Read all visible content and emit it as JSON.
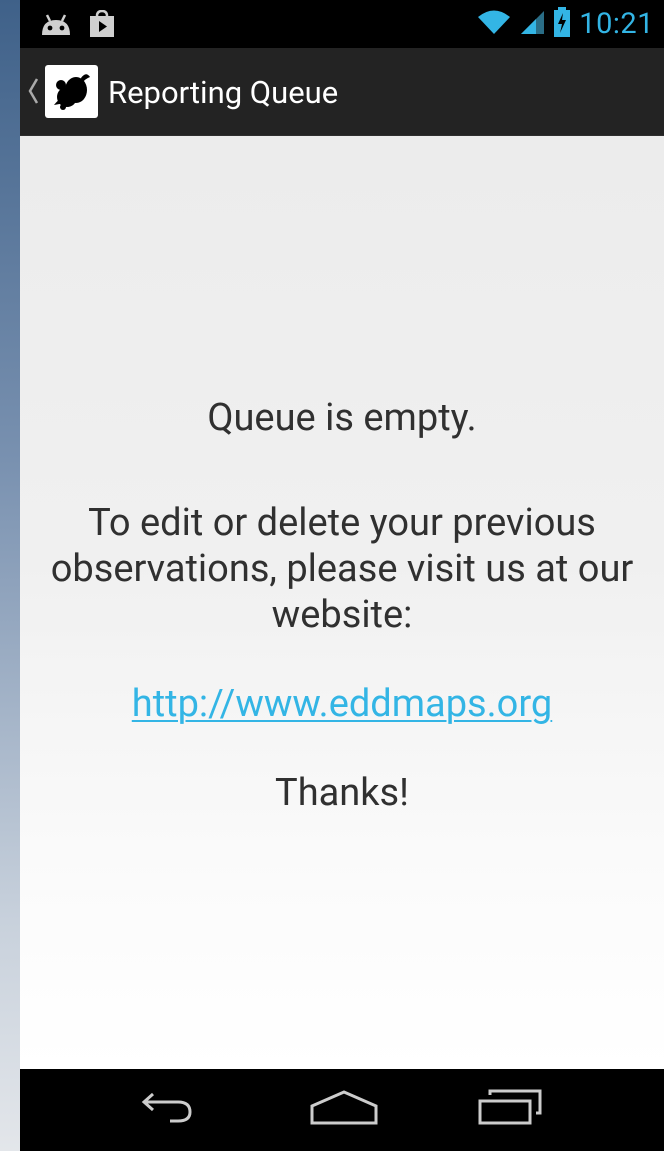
{
  "status_bar": {
    "time": "10:21",
    "left_icons": [
      "android-notification-icon",
      "play-store-icon"
    ],
    "right_icons": [
      "wifi-icon",
      "signal-icon",
      "battery-charging-icon"
    ]
  },
  "action_bar": {
    "title": "Reporting Queue",
    "icon": "app-logo"
  },
  "content": {
    "empty_message": "Queue is empty.",
    "edit_message": "To edit or delete your previous observations, please visit us at our website:",
    "link": "http://www.eddmaps.org",
    "thanks": "Thanks!"
  },
  "nav_bar": {
    "buttons": [
      "back-icon",
      "home-icon",
      "recent-apps-icon"
    ]
  },
  "colors": {
    "accent": "#33b5e5",
    "action_bar": "#232323",
    "text": "#303030"
  }
}
